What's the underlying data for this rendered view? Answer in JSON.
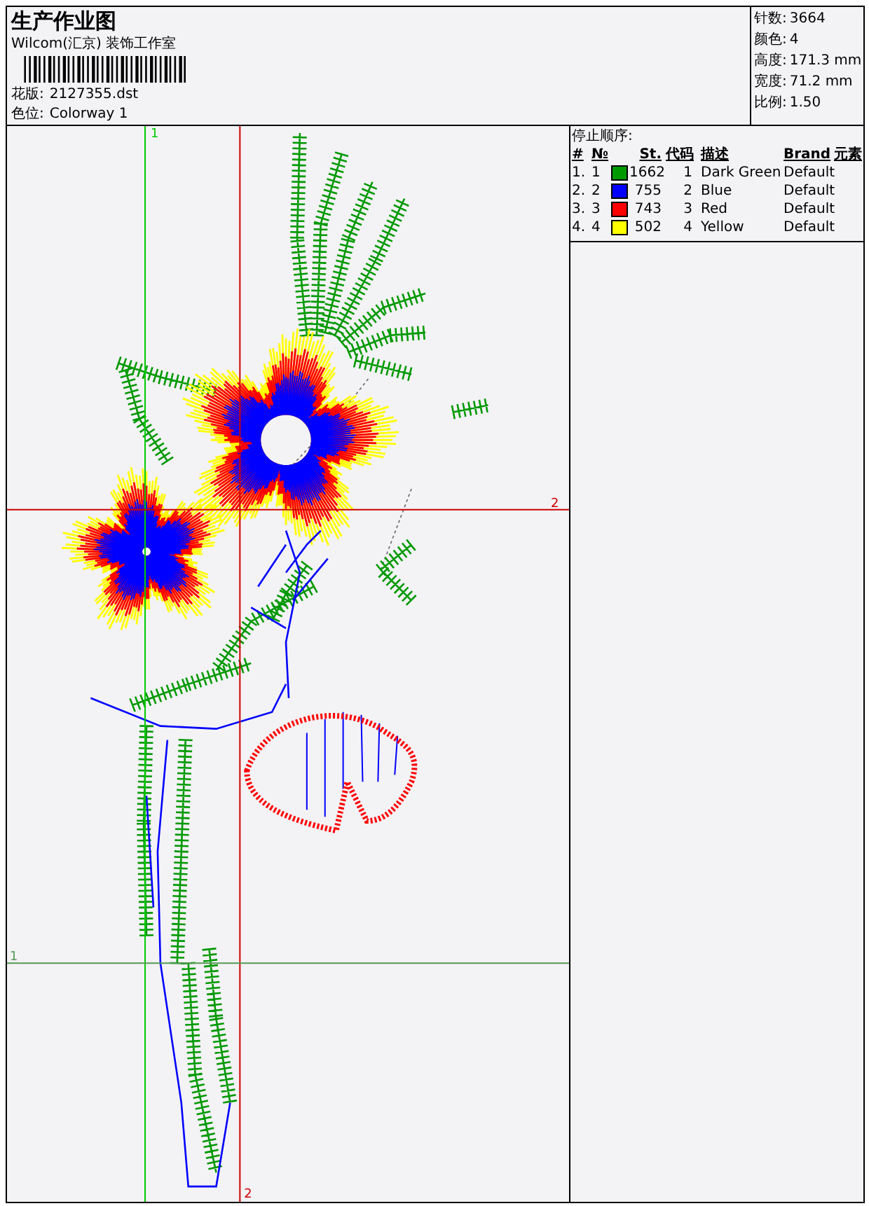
{
  "header": {
    "title": "生产作业图",
    "studio": "Wilcom(汇京) 装饰工作室",
    "design_label": "花版:",
    "design_value": "2127355.dst",
    "colorway_label": "色位:",
    "colorway_value": "Colorway 1"
  },
  "stats": [
    {
      "label": "针数:",
      "value": "3664"
    },
    {
      "label": "颜色:",
      "value": "4"
    },
    {
      "label": "高度:",
      "value": "171.3 mm"
    },
    {
      "label": "宽度:",
      "value": "71.2 mm"
    },
    {
      "label": "比例:",
      "value": "1.50"
    }
  ],
  "stop_sequence": {
    "title": "停止顺序:",
    "columns": [
      "#",
      "№",
      "St.",
      "代码",
      "描述",
      "Brand",
      "元素"
    ],
    "rows": [
      {
        "index": "1.",
        "number": "1",
        "color": "#009900",
        "stitches": "1662",
        "code": "1",
        "description": "Dark Green",
        "brand": "Default"
      },
      {
        "index": "2.",
        "number": "2",
        "color": "#0000ff",
        "stitches": "755",
        "code": "2",
        "description": "Blue",
        "brand": "Default"
      },
      {
        "index": "3.",
        "number": "3",
        "color": "#ff0000",
        "stitches": "743",
        "code": "3",
        "description": "Red",
        "brand": "Default"
      },
      {
        "index": "4.",
        "number": "4",
        "color": "#ffff00",
        "stitches": "502",
        "code": "4",
        "description": "Yellow",
        "brand": "Default"
      }
    ]
  },
  "guides": [
    {
      "kind": "vertical",
      "color": "#00cc00",
      "label": "1"
    },
    {
      "kind": "vertical",
      "color": "#cc0000",
      "label": "2"
    },
    {
      "kind": "horizontal",
      "color": "#cc0000",
      "label": "2"
    },
    {
      "kind": "horizontal",
      "color": "#559955",
      "label": "1"
    }
  ]
}
